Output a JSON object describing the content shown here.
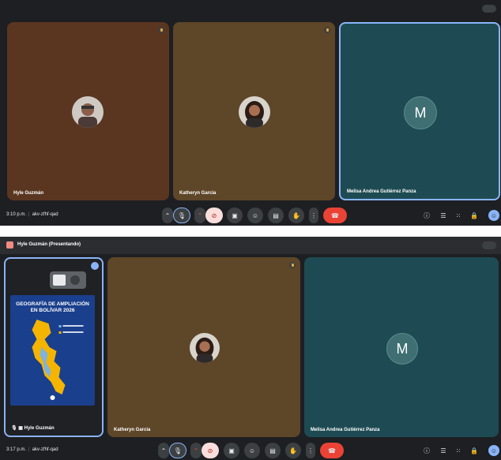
{
  "colors": {
    "meet_bg": "#1d1f22",
    "accent": "#8ab4f8",
    "end_call": "#ea4335",
    "camera_off": "#f9dedc"
  },
  "panel1": {
    "participants": [
      {
        "name": "Hyle Guzmán"
      },
      {
        "name": "Katheryn Garcia"
      },
      {
        "name": "Melisa Andrea Gutiérrez Panza",
        "initial": "M"
      }
    ],
    "bottom": {
      "time": "3:10 p.m.",
      "code": "akv-zfhf-qad"
    }
  },
  "panel2": {
    "presenter_banner": "Hyle Guzmán (Presentando)",
    "slide": {
      "title": "GEOGRAFÍA DE AMPLIACIÓN EN BOLÍVAR 2026"
    },
    "participants": [
      {
        "name": "Hyle Guzmán"
      },
      {
        "name": "Katheryn Garcia"
      },
      {
        "name": "Melisa Andrea Gutiérrez Panza",
        "initial": "M"
      }
    ],
    "bottom": {
      "time": "3:17 p.m.",
      "code": "akv-zfhf-qad"
    }
  }
}
